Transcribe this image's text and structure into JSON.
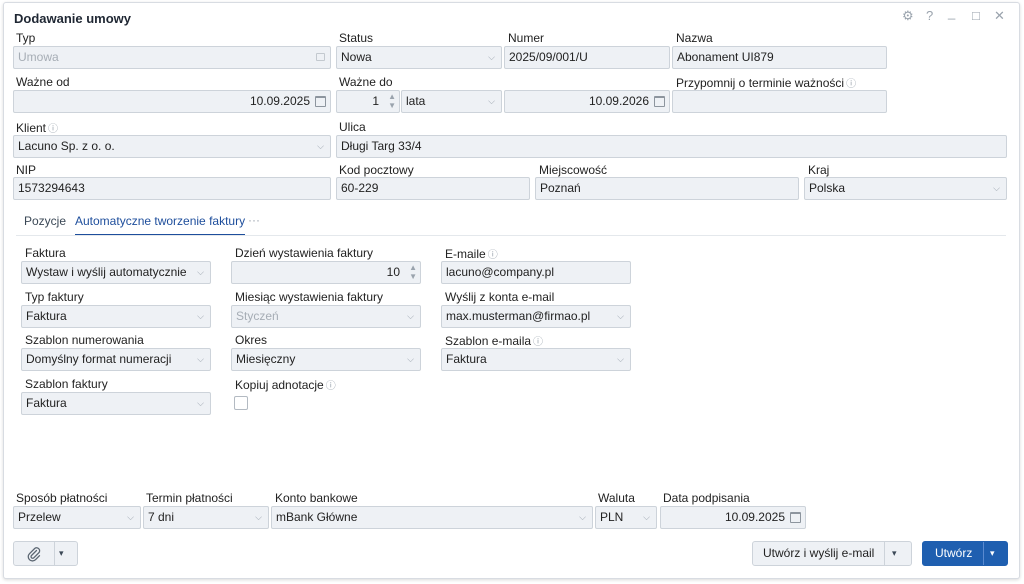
{
  "window": {
    "title": "Dodawanie umowy",
    "controls": [
      "⚙",
      "?",
      "_",
      "□",
      "✕"
    ]
  },
  "row1": {
    "typ": {
      "label": "Typ",
      "value": "Umowa"
    },
    "status": {
      "label": "Status",
      "value": "Nowa"
    },
    "numer": {
      "label": "Numer",
      "value": "2025/09/001/U"
    },
    "nazwa": {
      "label": "Nazwa",
      "value": "Abonament UI879"
    }
  },
  "row2": {
    "wazne_od": {
      "label": "Ważne od",
      "value": "10.09.2025"
    },
    "wazne_do": {
      "label": "Ważne do",
      "count": "1",
      "unit": "lata",
      "date": "10.09.2026"
    },
    "przypomnij": {
      "label": "Przypomnij o terminie ważności",
      "value": ""
    }
  },
  "row3": {
    "klient": {
      "label": "Klient",
      "value": "Lacuno Sp. z o. o."
    },
    "ulica": {
      "label": "Ulica",
      "value": "Długi Targ 33/4"
    }
  },
  "row4": {
    "nip": {
      "label": "NIP",
      "value": "1573294643"
    },
    "kod": {
      "label": "Kod pocztowy",
      "value": "60-229"
    },
    "miejscowosc": {
      "label": "Miejscowość",
      "value": "Poznań"
    },
    "kraj": {
      "label": "Kraj",
      "value": "Polska"
    }
  },
  "tabs": {
    "pozycje": "Pozycje",
    "auto": "Automatyczne tworzenie faktury",
    "more": "···"
  },
  "invoice": {
    "faktura": {
      "label": "Faktura",
      "value": "Wystaw i wyślij automatycznie"
    },
    "typ_faktury": {
      "label": "Typ faktury",
      "value": "Faktura"
    },
    "szablon_num": {
      "label": "Szablon numerowania",
      "value": "Domyślny format numeracji"
    },
    "szablon_faktury": {
      "label": "Szablon faktury",
      "value": "Faktura"
    },
    "dzien": {
      "label": "Dzień wystawienia faktury",
      "value": "10"
    },
    "miesiac": {
      "label": "Miesiąc wystawienia faktury",
      "value": "Styczeń"
    },
    "okres": {
      "label": "Okres",
      "value": "Miesięczny"
    },
    "kopiuj": {
      "label": "Kopiuj adnotacje",
      "checked": false
    },
    "emaile": {
      "label": "E-maile",
      "value": "lacuno@company.pl"
    },
    "wyslij_z": {
      "label": "Wyślij z konta e-mail",
      "value": "max.musterman@firmao.pl"
    },
    "szablon_email": {
      "label": "Szablon e-maila",
      "value": "Faktura"
    }
  },
  "footer": {
    "sposob": {
      "label": "Sposób płatności",
      "value": "Przelew"
    },
    "termin": {
      "label": "Termin płatności",
      "value": "7 dni"
    },
    "konto": {
      "label": "Konto bankowe",
      "value": "mBank Główne"
    },
    "waluta": {
      "label": "Waluta",
      "value": "PLN"
    },
    "data": {
      "label": "Data podpisania",
      "value": "10.09.2025"
    }
  },
  "buttons": {
    "create_send": "Utwórz i wyślij e-mail",
    "create": "Utwórz",
    "caret": "▾",
    "attach_icon": "paperclip-icon"
  },
  "glyphs": {
    "info": "ⓘ",
    "chevron": "⌵",
    "spin": "⌃⌄"
  }
}
